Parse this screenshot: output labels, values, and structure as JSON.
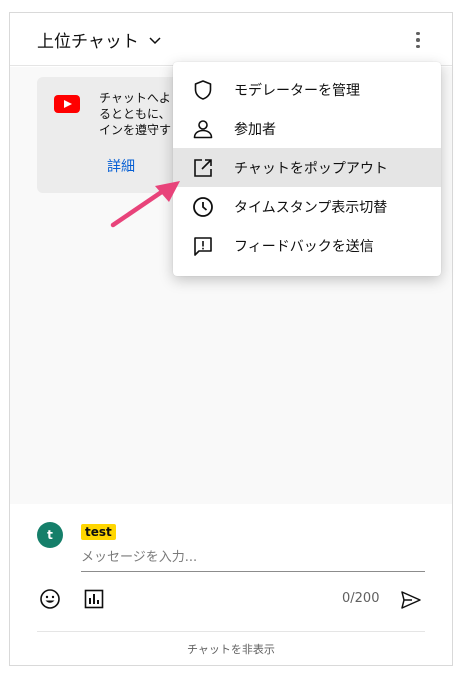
{
  "header": {
    "title": "上位チャット"
  },
  "notice": {
    "text": "チャットへよ\nるとともに、\nインを遵守す",
    "link": "詳細"
  },
  "menu": {
    "items": [
      {
        "label": "モデレーターを管理",
        "icon": "shield-icon"
      },
      {
        "label": "参加者",
        "icon": "person-icon"
      },
      {
        "label": "チャットをポップアウト",
        "icon": "popout-icon",
        "highlighted": true
      },
      {
        "label": "タイムスタンプ表示切替",
        "icon": "clock-icon"
      },
      {
        "label": "フィードバックを送信",
        "icon": "feedback-icon"
      }
    ]
  },
  "input": {
    "avatar_letter": "t",
    "author_name": "test",
    "placeholder": "メッセージを入力...",
    "value": "",
    "counter": "0/200",
    "hide_chat": "チャットを非表示"
  },
  "colors": {
    "youtube_red": "#ff0000",
    "link_blue": "#065fd4",
    "author_chip": "#ffd600",
    "avatar_bg": "#157f6a",
    "arrow_pink": "#e8437a"
  }
}
